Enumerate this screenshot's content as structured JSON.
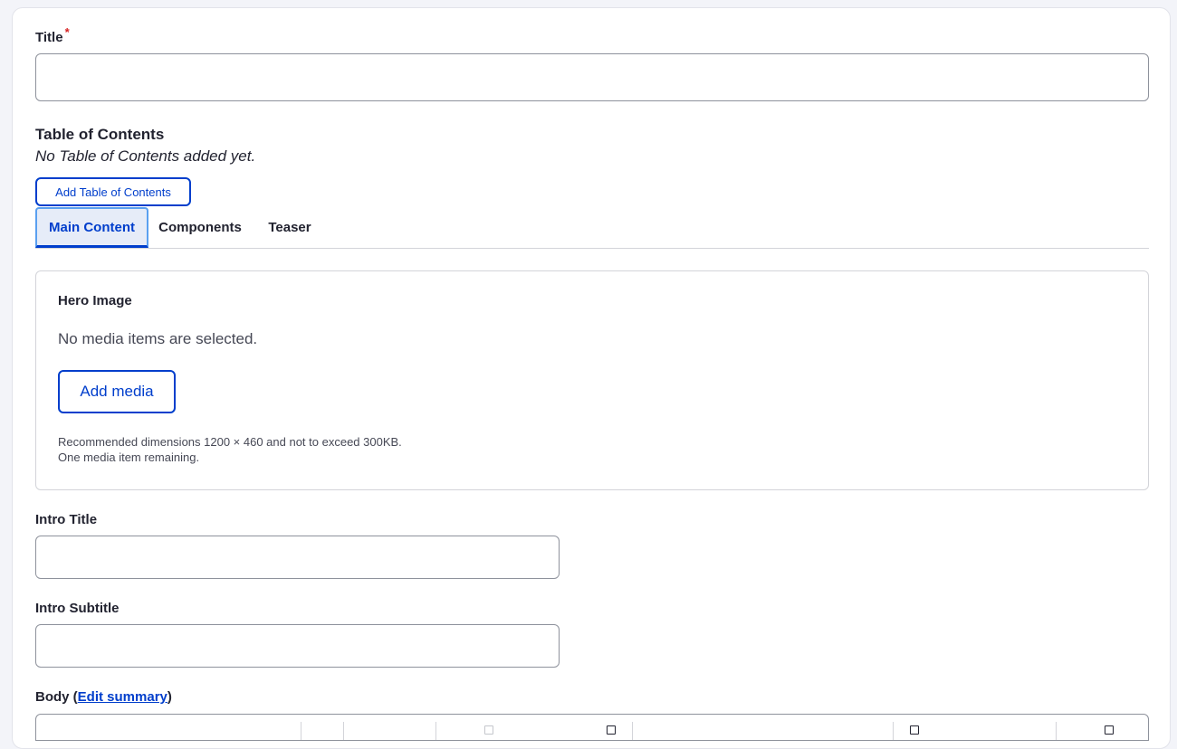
{
  "form": {
    "title_label": "Title",
    "required_marker": "*",
    "title_value": "",
    "toc": {
      "heading": "Table of Contents",
      "empty_text": "No Table of Contents added yet.",
      "add_button": "Add Table of Contents"
    },
    "tabs": [
      {
        "label": "Main Content",
        "active": true
      },
      {
        "label": "Components",
        "active": false
      },
      {
        "label": "Teaser",
        "active": false
      }
    ],
    "hero": {
      "title": "Hero Image",
      "empty_text": "No media items are selected.",
      "add_button": "Add media",
      "description_line1": "Recommended dimensions 1200 × 460 and not to exceed 300KB.",
      "description_line2": "One media item remaining."
    },
    "intro_title_label": "Intro Title",
    "intro_title_value": "",
    "intro_subtitle_label": "Intro Subtitle",
    "intro_subtitle_value": "",
    "body": {
      "label_prefix": "Body (",
      "edit_summary_link": "Edit summary",
      "label_suffix": ")"
    }
  },
  "colors": {
    "accent": "#003ecc",
    "active_tab_bg": "#e6ecf8",
    "required": "#d72222",
    "border": "#8e929c"
  }
}
